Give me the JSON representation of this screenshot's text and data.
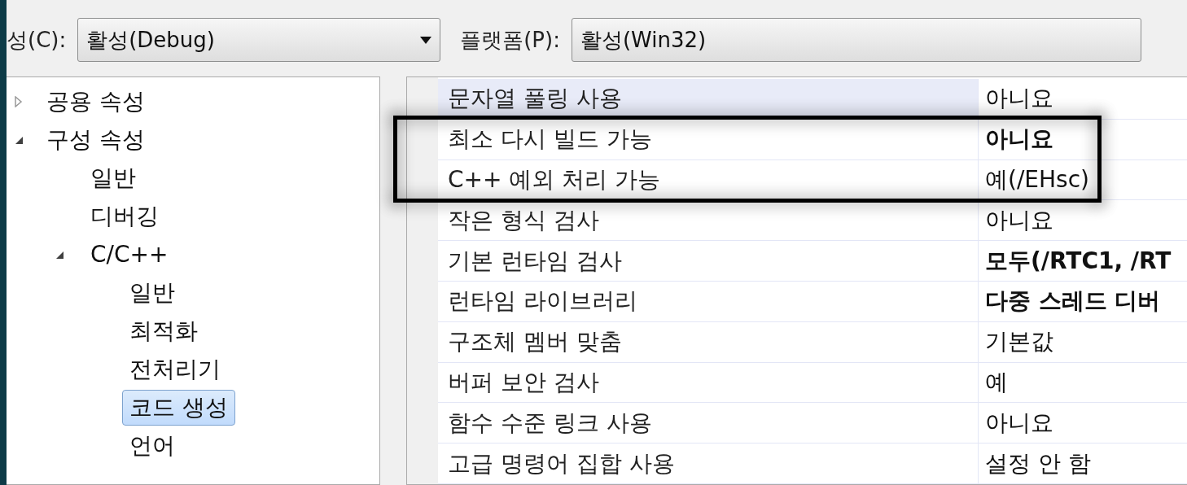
{
  "toolbar": {
    "configuration_label": "성(C):",
    "configuration_value": "활성(Debug)",
    "platform_label": "플랫폼(P):",
    "platform_value": "활성(Win32)"
  },
  "tree": [
    {
      "label": "공용 속성",
      "expanded": false,
      "selected": false
    },
    {
      "label": "구성 속성",
      "expanded": true,
      "selected": false,
      "children": [
        {
          "label": "일반",
          "selected": false
        },
        {
          "label": "디버깅",
          "selected": false
        },
        {
          "label": "C/C++",
          "expanded": true,
          "selected": false,
          "children": [
            {
              "label": "일반",
              "selected": false
            },
            {
              "label": "최적화",
              "selected": false
            },
            {
              "label": "전처리기",
              "selected": false
            },
            {
              "label": "코드 생성",
              "selected": true
            },
            {
              "label": "언어",
              "selected": false
            }
          ]
        }
      ]
    }
  ],
  "properties": [
    {
      "name": "문자열 풀링 사용",
      "value": "아니요",
      "modified": false,
      "selected": true
    },
    {
      "name": "최소 다시 빌드 가능",
      "value": "아니요",
      "modified": true,
      "selected": false
    },
    {
      "name": "C++ 예외 처리 가능",
      "value": "예(/EHsc)",
      "modified": false,
      "selected": false
    },
    {
      "name": "작은 형식 검사",
      "value": "아니요",
      "modified": false,
      "selected": false
    },
    {
      "name": "기본 런타임 검사",
      "value": "모두(/RTC1, /RT",
      "modified": true,
      "selected": false
    },
    {
      "name": "런타임 라이브러리",
      "value": "다중 스레드 디버",
      "modified": true,
      "selected": false
    },
    {
      "name": "구조체 멤버 맞춤",
      "value": "기본값",
      "modified": false,
      "selected": false
    },
    {
      "name": "버퍼 보안 검사",
      "value": "예",
      "modified": false,
      "selected": false
    },
    {
      "name": "함수 수준 링크 사용",
      "value": "아니요",
      "modified": false,
      "selected": false
    },
    {
      "name": "고급 명령어 집합 사용",
      "value": "설정 안 함",
      "modified": false,
      "selected": false
    }
  ],
  "annotation": {
    "kind": "frame"
  }
}
